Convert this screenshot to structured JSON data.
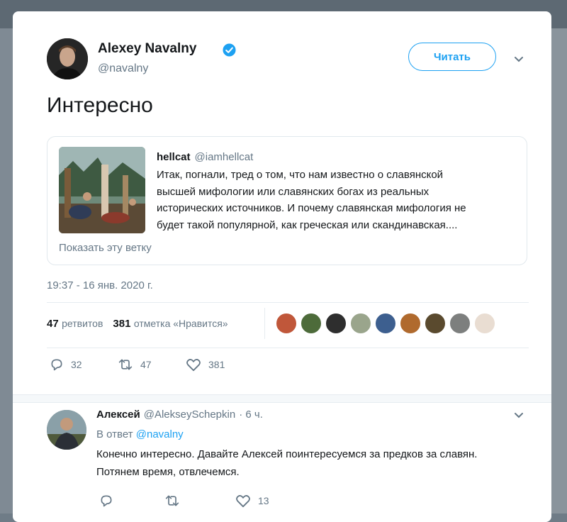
{
  "tweet": {
    "author_name": "Alexey Navalny",
    "author_handle": "@navalny",
    "follow_label": "Читать",
    "text": "Интересно",
    "timestamp": "19:37 - 16 янв. 2020 г.",
    "retweets_count": "47",
    "retweets_label": "ретвитов",
    "likes_count": "381",
    "likes_label": "отметка «Нравится»",
    "actions": {
      "replies": "32",
      "retweets": "47",
      "likes": "381"
    },
    "liker_avatars": [
      "liker-1",
      "liker-2",
      "liker-3",
      "liker-4",
      "liker-5",
      "liker-6",
      "liker-7",
      "liker-8",
      "liker-9"
    ]
  },
  "quoted": {
    "name": "hellcat",
    "handle": "@iamhellcat",
    "text_lines": [
      "Итак, погнали, тред о том, что нам известно о славянской",
      "высшей мифологии или славянских богах из реальных",
      "исторических источников. И почему славянская мифология не",
      "будет такой популярной, как греческая или скандинавская...."
    ],
    "show_thread": "Показать эту ветку"
  },
  "reply": {
    "name": "Алексей",
    "handle": "@AlekseySchepkin",
    "time": "· 6 ч.",
    "in_reply_prefix": "В ответ",
    "in_reply_handle": "@navalny",
    "text_lines": [
      "Конечно интересно. Давайте Алексей поинтересуемся за предков за славян.",
      "Потянем время, отвлечемся."
    ],
    "actions": {
      "replies": "",
      "retweets": "",
      "likes": "13"
    }
  },
  "colors": {
    "accent": "#1da1f2",
    "verified": "#1da1f2",
    "muted": "#657786"
  },
  "icons": [
    "verified-badge-icon",
    "chevron-down-icon",
    "reply-icon",
    "retweet-icon",
    "like-icon"
  ]
}
